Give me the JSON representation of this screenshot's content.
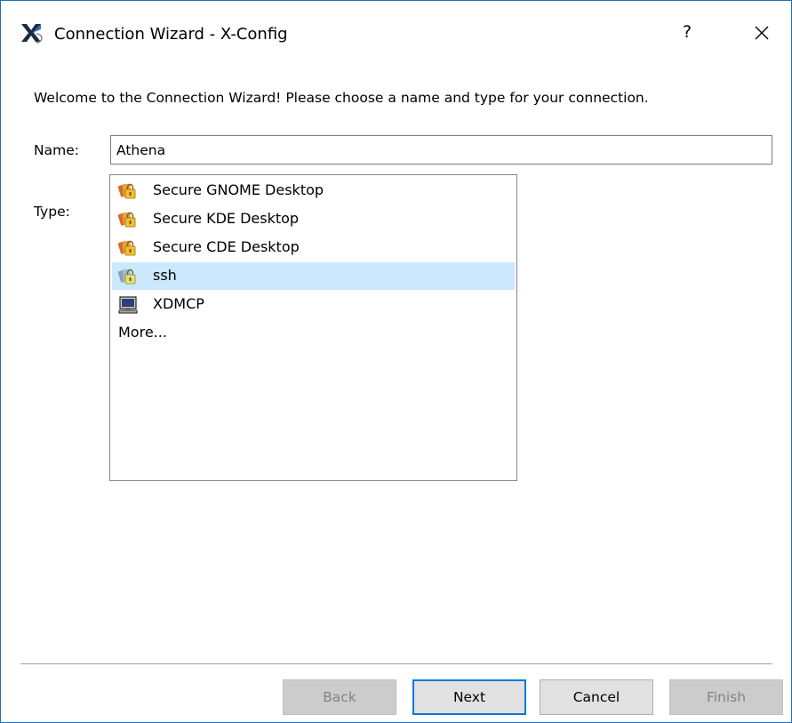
{
  "window": {
    "title": "Connection Wizard - X-Config",
    "help_glyph": "?",
    "app_icon": "x-config-logo-icon",
    "close_icon": "close-icon"
  },
  "wizard": {
    "welcome_text": "Welcome to the Connection Wizard!  Please choose a name and type for your connection.",
    "name_label": "Name:",
    "name_value": "Athena",
    "type_label": "Type:",
    "types": [
      {
        "label": "Secure GNOME Desktop",
        "icon": "secure-cards-icon",
        "selected": false
      },
      {
        "label": "Secure KDE Desktop",
        "icon": "secure-cards-icon",
        "selected": false
      },
      {
        "label": "Secure CDE Desktop",
        "icon": "secure-cards-icon",
        "selected": false
      },
      {
        "label": "ssh",
        "icon": "ssh-cards-icon",
        "selected": true
      },
      {
        "label": "XDMCP",
        "icon": "monitor-icon",
        "selected": false
      },
      {
        "label": "More...",
        "icon": "",
        "selected": false
      }
    ]
  },
  "buttons": {
    "back": {
      "label": "Back",
      "enabled": false
    },
    "next": {
      "label": "Next",
      "enabled": true,
      "default": true
    },
    "cancel": {
      "label": "Cancel",
      "enabled": true
    },
    "finish": {
      "label": "Finish",
      "enabled": false
    }
  },
  "colors": {
    "selection": "#cce8ff",
    "focus_border": "#0078d7",
    "window_border": "#1f6fb5",
    "disabled_text": "#838383"
  }
}
